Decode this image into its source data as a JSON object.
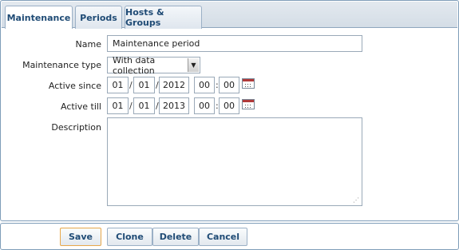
{
  "tabs": [
    {
      "label": "Maintenance",
      "active": true
    },
    {
      "label": "Periods",
      "active": false
    },
    {
      "label": "Hosts & Groups",
      "active": false
    }
  ],
  "form": {
    "name_label": "Name",
    "name_value": "Maintenance period",
    "type_label": "Maintenance type",
    "type_value": "With data collection",
    "since_label": "Active since",
    "since": {
      "day": "01",
      "month": "01",
      "year": "2012",
      "hour": "00",
      "minute": "00"
    },
    "till_label": "Active till",
    "till": {
      "day": "01",
      "month": "01",
      "year": "2013",
      "hour": "00",
      "minute": "00"
    },
    "date_sep": "/",
    "time_sep": ":",
    "description_label": "Description",
    "description_value": ""
  },
  "buttons": {
    "save": "Save",
    "clone": "Clone",
    "delete": "Delete",
    "cancel": "Cancel"
  },
  "colors": {
    "accent": "#1f4b75",
    "border": "#7f9db9",
    "save_border": "#e8a84a",
    "calendar_header": "#b03a3a"
  }
}
